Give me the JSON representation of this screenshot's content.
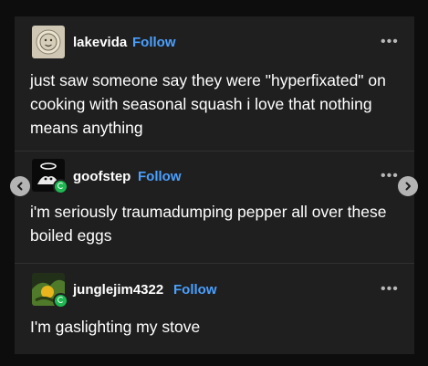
{
  "posts": [
    {
      "username": "lakevida",
      "follow_label": "Follow",
      "more_label": "•••",
      "text": "just saw someone say they were \"hyperfixated\" on cooking with seasonal squash i love that nothing means anything"
    },
    {
      "username": "goofstep",
      "follow_label": "Follow",
      "more_label": "•••",
      "text": "i'm seriously traumadumping pepper all over these boiled eggs"
    },
    {
      "username": "junglejim4322",
      "follow_label": "Follow",
      "more_label": "•••",
      "text": "I'm gaslighting my stove"
    }
  ],
  "colors": {
    "background": "#0d0d0d",
    "card": "#1f1f1f",
    "follow": "#4aa0ff",
    "badge": "#1fb852",
    "text": "#ffffff"
  },
  "icons": {
    "prev": "chevron-left-icon",
    "next": "chevron-right-icon",
    "more": "more-dots-icon",
    "badge": "online-badge-icon"
  }
}
